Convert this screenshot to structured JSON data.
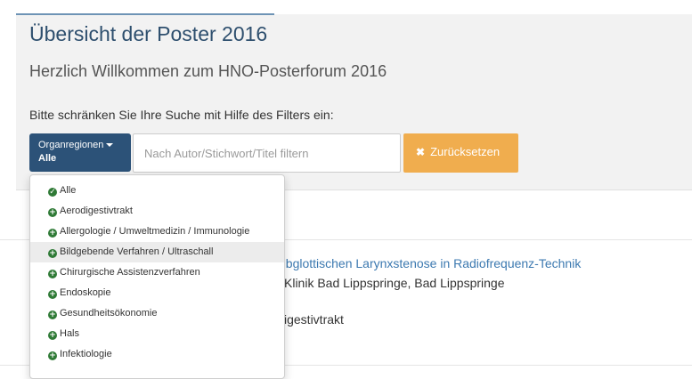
{
  "page": {
    "title": "Übersicht der Poster 2016",
    "welcome": "Herzlich Willkommen zum HNO-Posterforum 2016",
    "filter_hint": "Bitte schränken Sie Ihre Suche mit Hilfe des Filters ein:"
  },
  "filter": {
    "region_button_label": "Organregionen",
    "region_selected": "Alle",
    "search_placeholder": "Nach Autor/Stichwort/Titel filtern",
    "reset_label": "Zurücksetzen"
  },
  "dropdown": {
    "items": [
      {
        "label": "Alle",
        "icon": "check-circle-icon"
      },
      {
        "label": "Aerodigestivtrakt",
        "icon": "plus-circle-icon"
      },
      {
        "label": "Allergologie / Umweltmedizin / Immunologie",
        "icon": "plus-circle-icon"
      },
      {
        "label": "Bildgebende Verfahren / Ultraschall",
        "icon": "plus-circle-icon"
      },
      {
        "label": "Chirurgische Assistenzverfahren",
        "icon": "plus-circle-icon"
      },
      {
        "label": "Endoskopie",
        "icon": "plus-circle-icon"
      },
      {
        "label": "Gesundheitsökonomie",
        "icon": "plus-circle-icon"
      },
      {
        "label": "Hals",
        "icon": "plus-circle-icon"
      },
      {
        "label": "Infektiologie",
        "icon": "plus-circle-icon"
      }
    ]
  },
  "poster": {
    "title_partial": "ubglottischen Larynxstenose in Radiofrequenz-Technik",
    "location_partial": "Klinik Bad Lippspringe, Bad Lippspringe",
    "region_partial": "igestivtrakt"
  },
  "colors": {
    "primary": "#2c5278",
    "warning": "#f0ad4e",
    "success_icon": "#2f7a36",
    "link": "#3c79b0"
  }
}
